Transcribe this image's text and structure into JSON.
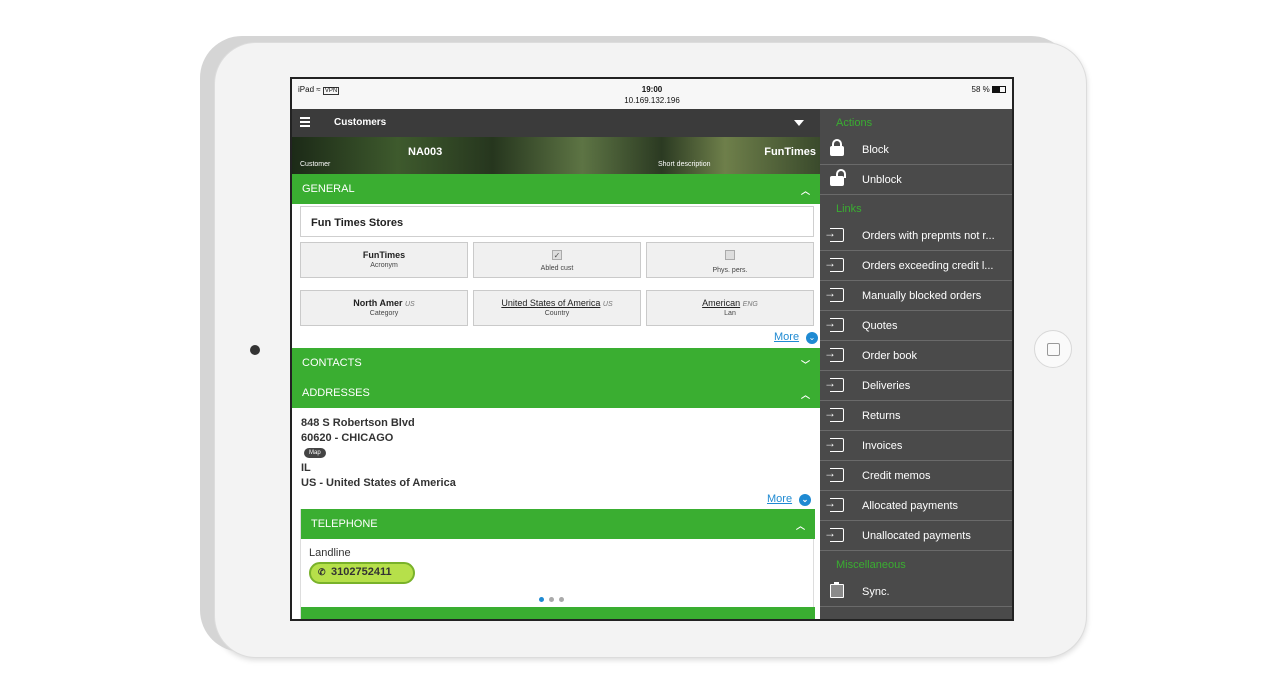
{
  "status": {
    "device": "iPad",
    "vpn": "VPN",
    "time": "19:00",
    "address": "10.169.132.196",
    "battery": "58 %"
  },
  "appbar": {
    "title": "Customers"
  },
  "banner": {
    "code": "NA003",
    "code_label": "Customer",
    "short_desc": "FunTimes",
    "short_desc_label": "Short description"
  },
  "general": {
    "header": "GENERAL",
    "name": "Fun Times Stores",
    "acronym": {
      "value": "FunTimes",
      "label": "Acronym"
    },
    "abled_cust": {
      "label": "Abled cust",
      "checked": true
    },
    "phys_pers": {
      "label": "Phys. pers.",
      "checked": false
    },
    "category": {
      "value": "North Amer",
      "code": "US",
      "label": "Category"
    },
    "country": {
      "value": "United States of America",
      "code": "US",
      "label": "Country"
    },
    "lan": {
      "value": "American",
      "code": "ENG",
      "label": "Lan"
    },
    "more": "More"
  },
  "contacts": {
    "header": "CONTACTS"
  },
  "addresses": {
    "header": "ADDRESSES",
    "street": "848 S Robertson Blvd",
    "city": "60620 - CHICAGO",
    "map": "Map",
    "state": "IL",
    "country": "US - United States of America",
    "more": "More"
  },
  "telephone": {
    "header": "TELEPHONE",
    "type": "Landline",
    "number": "3102752411"
  },
  "sidebar": {
    "actions_label": "Actions",
    "actions": [
      {
        "label": "Block",
        "icon": "lock-icon"
      },
      {
        "label": "Unblock",
        "icon": "unlock-icon"
      }
    ],
    "links_label": "Links",
    "links": [
      {
        "label": "Orders with prepmts not r...",
        "icon": "link-icon"
      },
      {
        "label": "Orders exceeding credit l...",
        "icon": "link-icon"
      },
      {
        "label": "Manually blocked orders",
        "icon": "link-icon"
      },
      {
        "label": "Quotes",
        "icon": "link-icon"
      },
      {
        "label": "Order book",
        "icon": "link-icon"
      },
      {
        "label": "Deliveries",
        "icon": "link-icon"
      },
      {
        "label": "Returns",
        "icon": "link-icon"
      },
      {
        "label": "Invoices",
        "icon": "link-icon"
      },
      {
        "label": "Credit memos",
        "icon": "link-icon"
      },
      {
        "label": "Allocated payments",
        "icon": "link-icon"
      },
      {
        "label": "Unallocated payments",
        "icon": "link-icon"
      }
    ],
    "misc_label": "Miscellaneous",
    "misc": [
      {
        "label": "Sync.",
        "icon": "clipboard-icon"
      }
    ]
  },
  "colors": {
    "accent_green": "#3aae31",
    "sidebar_bg": "#4a4a4a",
    "link_blue": "#1f8ad2"
  }
}
